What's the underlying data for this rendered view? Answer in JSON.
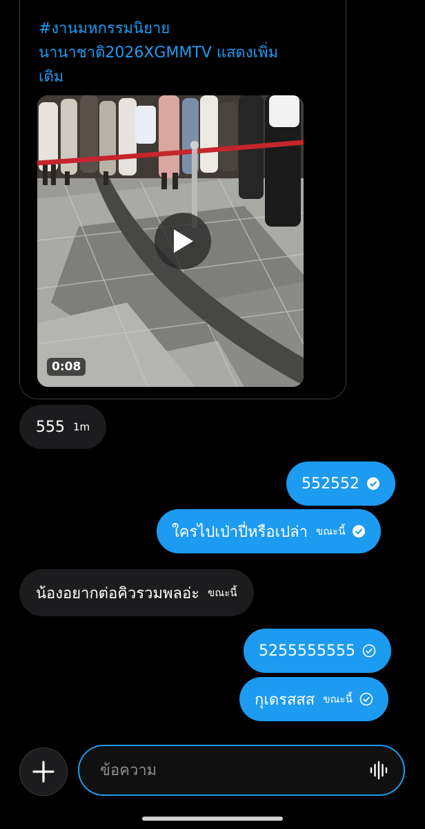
{
  "shared_post": {
    "hashtag_line1": "#งานมหกรรมนิยาย",
    "hashtag_line2": "นานาชาติ2026XGMMTV แสดงเพิ่ม",
    "hashtag_line3": "เติม",
    "video_duration": "0:08"
  },
  "messages": [
    {
      "text": "555",
      "time": "1m",
      "direction": "incoming"
    },
    {
      "text": "552552",
      "time": "",
      "direction": "outgoing",
      "status": "read"
    },
    {
      "text": "ใครไปเป่าปี่หรือเปล่า",
      "time": "ขณะนี้",
      "direction": "outgoing",
      "status": "read"
    },
    {
      "text": "น้องอยากต่อคิวรวมพลอ่ะ",
      "time": "ขณะนี้",
      "direction": "incoming"
    },
    {
      "text": "5255555555",
      "time": "",
      "direction": "outgoing",
      "status": "sent"
    },
    {
      "text": "กุเดรสสส",
      "time": "ขณะนี้",
      "direction": "outgoing",
      "status": "sent"
    }
  ],
  "composer": {
    "placeholder": "ข้อความ"
  },
  "colors": {
    "accent": "#1d9bf0",
    "incoming_bubble": "#1c1c1e",
    "background": "#000000"
  },
  "icons": [
    "play-icon",
    "read-check-icon",
    "sent-check-icon",
    "plus-icon",
    "voice-icon"
  ]
}
